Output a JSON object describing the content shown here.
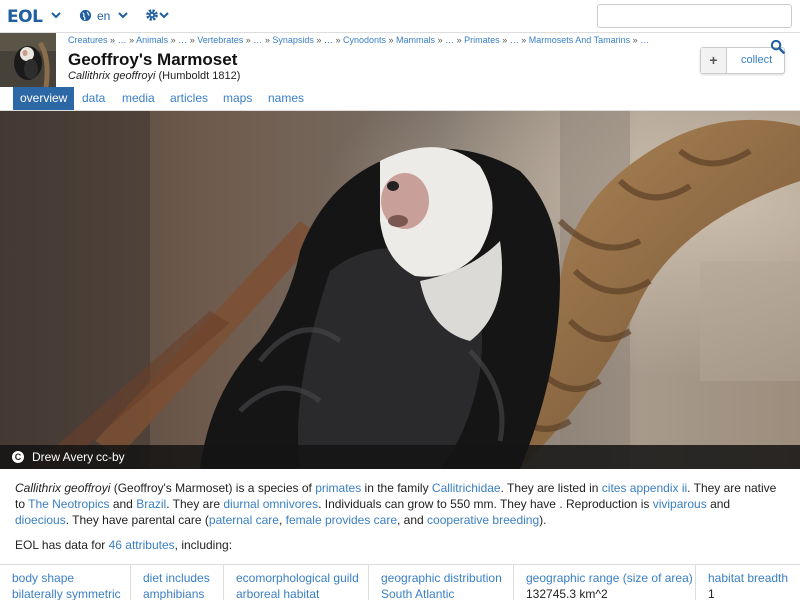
{
  "topbar": {
    "logo": "EOL",
    "language": "en",
    "search_value": ""
  },
  "header": {
    "breadcrumb": [
      {
        "label": "Creatures"
      },
      {
        "label": "…"
      },
      {
        "label": "Animals"
      },
      {
        "label": "…"
      },
      {
        "label": "Vertebrates"
      },
      {
        "label": "…"
      },
      {
        "label": "Synapsids"
      },
      {
        "label": "…"
      },
      {
        "label": "Cynodonts"
      },
      {
        "label": "Mammals"
      },
      {
        "label": "…"
      },
      {
        "label": "Primates"
      },
      {
        "label": "…"
      },
      {
        "label": "Marmosets And Tamarins"
      },
      {
        "label": "…"
      }
    ],
    "breadcrumb_separator": "»",
    "title": "Geoffroy's Marmoset",
    "scientific_name": "Callithrix geoffroyi",
    "authority": "(Humboldt 1812)",
    "collect_label": "collect",
    "collect_plus": "+"
  },
  "tabs": [
    {
      "label": "overview",
      "active": true
    },
    {
      "label": "data",
      "active": false
    },
    {
      "label": "media",
      "active": false
    },
    {
      "label": "articles",
      "active": false
    },
    {
      "label": "maps",
      "active": false
    },
    {
      "label": "names",
      "active": false
    }
  ],
  "hero": {
    "cc_symbol": "C",
    "author": "Drew Avery",
    "license": "cc-by"
  },
  "summary": {
    "sci": "Callithrix geoffroyi",
    "t1": " (Geoffroy's Marmoset) is a species of ",
    "l1": "primates",
    "t2": " in the family ",
    "l2": "Callitrichidae",
    "t3": ". They are listed in ",
    "l3": "cites appendix ii",
    "t4": ". They are native to ",
    "l4": "The Neotropics",
    "t5": " and ",
    "l5": "Brazil",
    "t6": ". They are ",
    "l6": "diurnal omnivores",
    "t7": ". Individuals can grow to 550 mm. They have . Reproduction is ",
    "l7": "viviparous",
    "t8": " and ",
    "l8": "dioecious",
    "t9": ". They have parental care (",
    "l9": "paternal care",
    "t10": ", ",
    "l10": "female provides care",
    "t11": ", and ",
    "l11": "cooperative breeding",
    "t12": ")."
  },
  "data_note": {
    "prefix": "EOL has data for ",
    "link": "46 attributes",
    "suffix": ", including:"
  },
  "attributes": [
    {
      "key": "body shape",
      "value": "bilaterally symmetric",
      "value_is_link": true
    },
    {
      "key": "diet includes",
      "value": "amphibians",
      "value_is_link": true
    },
    {
      "key": "ecomorphological guild",
      "value": "arboreal habitat",
      "value_is_link": true
    },
    {
      "key": "geographic distribution",
      "value": "South Atlantic",
      "value_is_link": true
    },
    {
      "key": "geographic range (size of area)",
      "value": "132745.3 km^2",
      "value_is_link": false
    },
    {
      "key": "habitat breadth",
      "value": "1",
      "value_is_link": false
    }
  ],
  "colors": {
    "link": "#3a7fc4",
    "active_tab": "#2d68a6",
    "brand": "#1f5fa0"
  },
  "icons": [
    "chevron-down-icon",
    "globe-icon",
    "gear-icon",
    "search-icon",
    "plus-icon",
    "creative-commons-icon"
  ]
}
